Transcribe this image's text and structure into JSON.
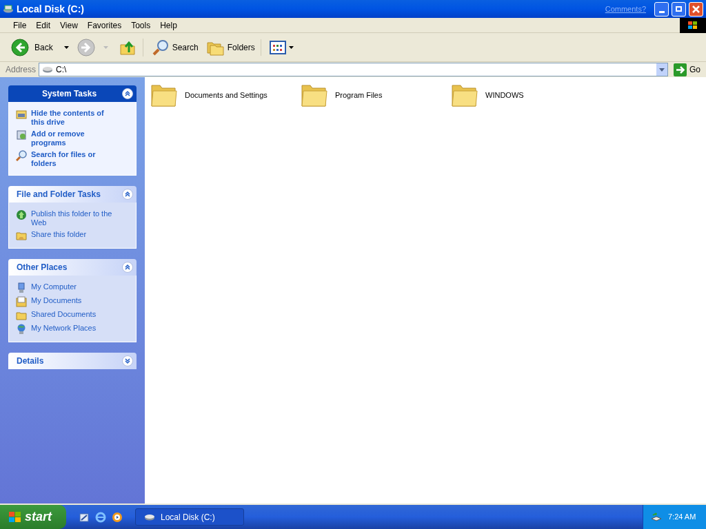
{
  "window": {
    "title": "Local Disk (C:)",
    "comments_link": "Comments?"
  },
  "menu": [
    "File",
    "Edit",
    "View",
    "Favorites",
    "Tools",
    "Help"
  ],
  "toolbar": [
    {
      "kind": "back",
      "label": "Back",
      "disabled": false
    },
    {
      "kind": "forward",
      "disabled": true
    },
    {
      "kind": "up"
    },
    {
      "kind": "search",
      "label": "Search"
    },
    {
      "kind": "folders",
      "label": "Folders"
    },
    {
      "kind": "views"
    }
  ],
  "address": {
    "label": "Address",
    "value": "C:\\",
    "go": "Go"
  },
  "panels": [
    {
      "title": "System Tasks",
      "kind": "special",
      "expanded": true,
      "items": [
        {
          "kind": "hide",
          "label": "Hide the contents of this drive"
        },
        {
          "kind": "addremove",
          "label": "Add or remove programs"
        },
        {
          "kind": "search",
          "label": "Search for files or folders"
        }
      ]
    },
    {
      "title": "File and Folder Tasks",
      "kind": "normal",
      "expanded": true,
      "items": [
        {
          "kind": "globe",
          "label": "Publish this folder to the Web"
        },
        {
          "kind": "share",
          "label": "Share this folder"
        }
      ]
    },
    {
      "title": "Other Places",
      "kind": "normal",
      "expanded": true,
      "items": [
        {
          "kind": "computer",
          "label": "My Computer"
        },
        {
          "kind": "documents",
          "label": "My Documents"
        },
        {
          "kind": "folder",
          "label": "Shared Documents"
        },
        {
          "kind": "network",
          "label": "My Network Places"
        }
      ]
    },
    {
      "title": "Details",
      "kind": "normal",
      "expanded": false
    }
  ],
  "files": [
    {
      "name": "Documents and Settings"
    },
    {
      "name": "Program Files"
    },
    {
      "name": "WINDOWS"
    }
  ],
  "taskbar": {
    "start": "start",
    "quick_launch": [
      {
        "kind": "explorer"
      },
      {
        "kind": "ie"
      },
      {
        "kind": "media"
      }
    ],
    "tasks": [
      {
        "label": "Local Disk (C:)",
        "selected": false
      }
    ],
    "clock": "7:24 AM"
  }
}
